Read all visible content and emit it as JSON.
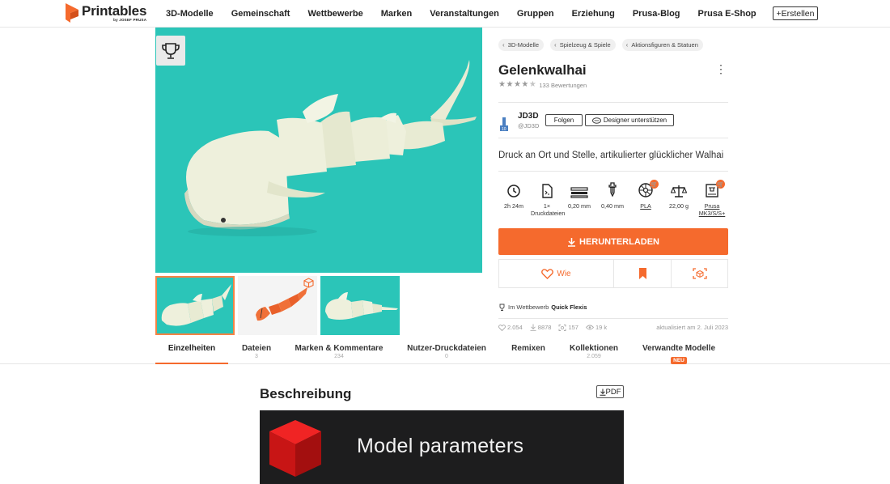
{
  "brand": {
    "name": "Printables",
    "sub": "by JOSEF PRUSA"
  },
  "nav": [
    {
      "label": "3D-Modelle"
    },
    {
      "label": "Gemeinschaft"
    },
    {
      "label": "Wettbewerbe"
    },
    {
      "label": "Marken"
    },
    {
      "label": "Veranstaltungen"
    },
    {
      "label": "Gruppen"
    },
    {
      "label": "Erziehung"
    },
    {
      "label": "Prusa-Blog"
    },
    {
      "label": "Prusa E-Shop"
    }
  ],
  "create_label": "+Erstellen",
  "breadcrumbs": [
    "3D-Modelle",
    "Spielzeug & Spiele",
    "Aktionsfiguren & Statuen"
  ],
  "model": {
    "title": "Gelenkwalhai",
    "rating": 4.5,
    "rating_count": "133 Bewertungen",
    "summary": "Druck an Ort und Stelle, artikulierter glücklicher Walhai"
  },
  "designer": {
    "name": "JD3D",
    "handle": "@JD3D",
    "follow_label": "Folgen",
    "support_label": "Designer unterstützen"
  },
  "params": [
    {
      "icon": "clock-icon",
      "value": "2h 24m"
    },
    {
      "icon": "file-icon",
      "value": "1×",
      "value2": "Druckdateien"
    },
    {
      "icon": "layer-height-icon",
      "value": "0,20 mm"
    },
    {
      "icon": "nozzle-icon",
      "value": "0,40 mm"
    },
    {
      "icon": "filament-spool-icon",
      "value": "PLA"
    },
    {
      "icon": "scale-icon",
      "value": "22,00 g"
    },
    {
      "icon": "printer-icon",
      "value": "Prusa",
      "value2": "MK3/S/S+"
    }
  ],
  "download_label": "HERUNTERLADEN",
  "like_label": "Wie",
  "contest": {
    "prefix": "Im Wettbewerb",
    "name": "Quick Flexis"
  },
  "stats": {
    "likes": "2.054",
    "downloads": "8878",
    "makes": "157",
    "views": "19 k",
    "updated": "aktualisiert am 2. Juli 2023"
  },
  "tabs": [
    {
      "label": "Einzelheiten",
      "count": ""
    },
    {
      "label": "Dateien",
      "count": "3"
    },
    {
      "label": "Marken & Kommentare",
      "count": "234"
    },
    {
      "label": "Nutzer-Druckdateien",
      "count": "0"
    },
    {
      "label": "Remixen",
      "count": ""
    },
    {
      "label": "Kollektionen",
      "count": "2.059"
    },
    {
      "label": "Verwandte Modelle",
      "badge": "NEU"
    }
  ],
  "description": {
    "title": "Beschreibung",
    "pdf_label": "PDF",
    "banner_text": "Model parameters"
  },
  "colors": {
    "accent": "#f56a2d",
    "teal": "#2bc5b8",
    "shark": "#eef0dc",
    "banner_bg": "#1d1d1e"
  }
}
